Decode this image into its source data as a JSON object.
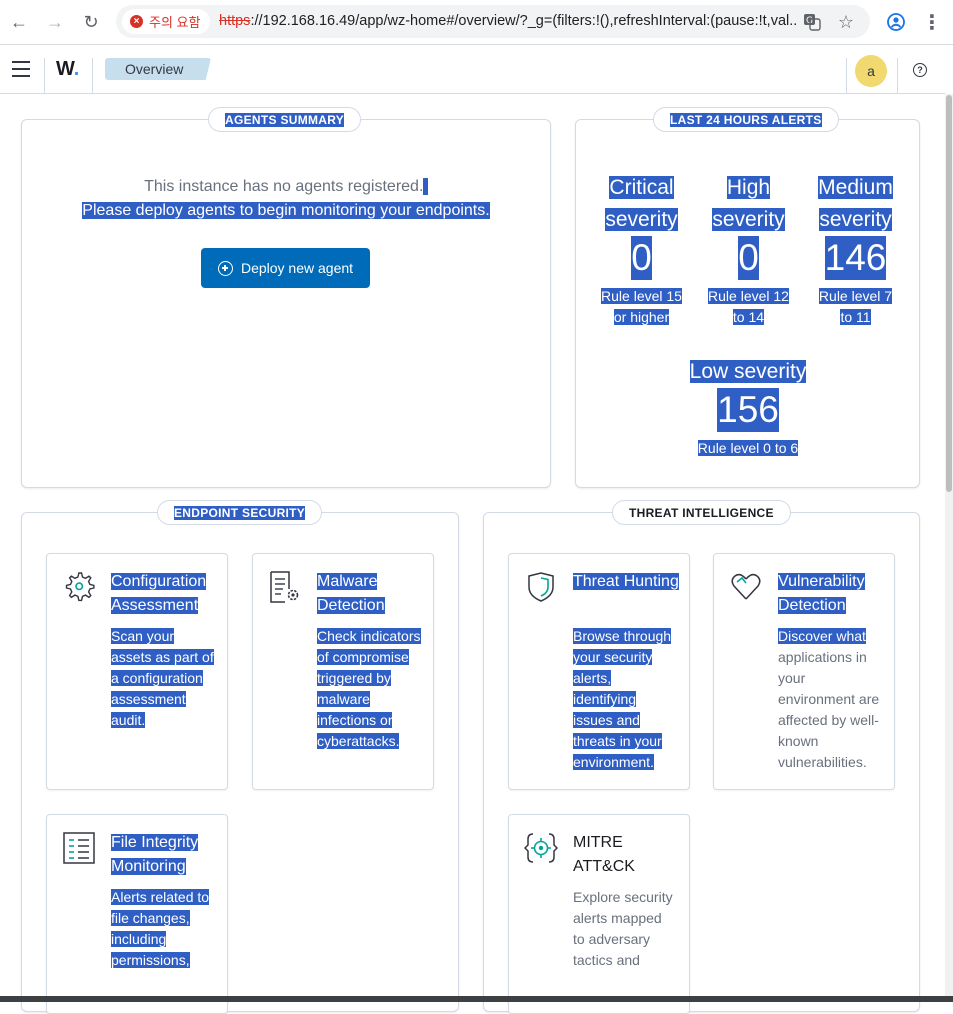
{
  "browser": {
    "security_label": "주의 요함",
    "url_scheme": "https",
    "url_rest": "://192.168.16.49/app/wz-home#/overview/?_g=(filters:!(),refreshInterval:(pause:!t,val..."
  },
  "header": {
    "logo": "W",
    "breadcrumb": "Overview",
    "avatar_initial": "a",
    "help": "?"
  },
  "agents_summary": {
    "title": "AGENTS SUMMARY",
    "line1": "This instance has no agents registered.",
    "line2": "Please deploy agents to begin monitoring your endpoints.",
    "deploy_label": "Deploy new agent"
  },
  "alerts": {
    "title": "LAST 24 HOURS ALERTS",
    "items": [
      {
        "title_1": "Critical",
        "title_2": "severity",
        "value": "0",
        "sub_1": "Rule level 15",
        "sub_2": "or higher"
      },
      {
        "title_1": "High",
        "title_2": "severity",
        "value": "0",
        "sub_1": "Rule level 12",
        "sub_2": "to 14"
      },
      {
        "title_1": "Medium",
        "title_2": "severity",
        "value": "146",
        "sub_1": "Rule level 7",
        "sub_2": "to 11"
      },
      {
        "title_1": "Low severity",
        "title_2": "",
        "value": "156",
        "sub_1": "Rule level 0 to 6",
        "sub_2": ""
      }
    ]
  },
  "endpoint_security": {
    "title": "ENDPOINT SECURITY",
    "cards": [
      {
        "title": "Configuration Assessment",
        "desc": "Scan your assets as part of a configuration assessment audit."
      },
      {
        "title": "Malware Detection",
        "desc": "Check indicators of compromise triggered by malware infections or cyberattacks."
      },
      {
        "title": "File Integrity Monitoring",
        "desc": "Alerts related to file changes, including permissions,"
      }
    ]
  },
  "threat_intelligence": {
    "title": "THREAT INTELLIGENCE",
    "cards": [
      {
        "title": "Threat Hunting",
        "desc": "Browse through your security alerts, identifying issues and threats in your environment."
      },
      {
        "title": "Vulnerability Detection",
        "desc_hl": "Discover what",
        "desc": "applications in your environment are affected by well-known vulnerabilities."
      },
      {
        "title": "MITRE ATT&CK",
        "desc": "Explore security alerts mapped to adversary tactics and"
      }
    ]
  },
  "colors": {
    "accent": "#006bb8",
    "selection": "#2f5fc4",
    "breadcrumb": "#c7deee",
    "avatar": "#f1d86f"
  }
}
